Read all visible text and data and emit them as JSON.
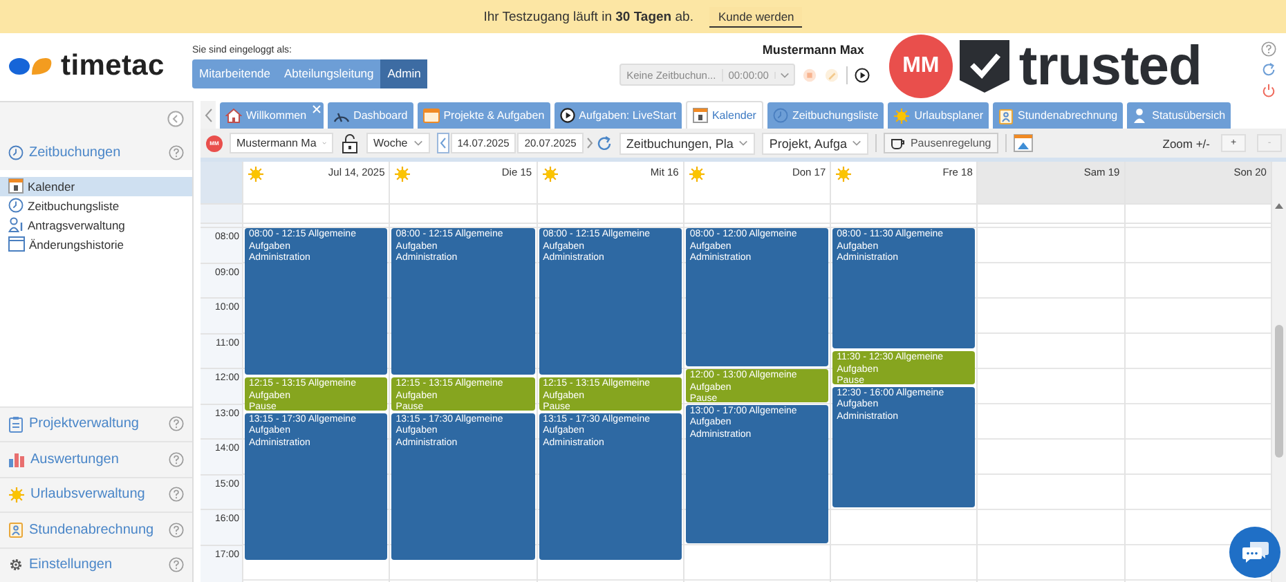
{
  "banner": {
    "message": "Ihr Testzugang läuft in **30 Tagen** ab.",
    "action": "Kunde werden"
  },
  "header": {
    "logo": "timetac",
    "login_label": "Sie sind eingeloggt als:",
    "roles": [
      {
        "label": "Mitarbeitende",
        "selected": false
      },
      {
        "label": "Abteilungsleitung",
        "selected": false
      },
      {
        "label": "Admin",
        "selected": true
      }
    ],
    "user_name": "Mustermann Max",
    "timer": {
      "value": "Keine Zeitbuchun...",
      "time": "00:00:00"
    },
    "avatar": "MM",
    "trust_badge": "trusted"
  },
  "sidebar": {
    "sections": [
      {
        "label": "Zeitbuchungen",
        "children": [
          {
            "label": "Kalender",
            "selected": true
          },
          {
            "label": "Zeitbuchungsliste",
            "selected": false
          },
          {
            "label": "Antragsverwaltung",
            "selected": false
          },
          {
            "label": "Änderungshistorie",
            "selected": false
          }
        ]
      },
      {
        "label": "Projektverwaltung"
      },
      {
        "label": "Auswertungen"
      },
      {
        "label": "Urlaubsverwaltung"
      },
      {
        "label": "Stundenabrechnung"
      },
      {
        "label": "Einstellungen"
      }
    ]
  },
  "tabs": [
    {
      "label": "Willkommen",
      "selected": false,
      "closable": true
    },
    {
      "label": "Dashboard",
      "selected": false,
      "closable": false
    },
    {
      "label": "Projekte & Aufgaben",
      "selected": false,
      "closable": false
    },
    {
      "label": "Aufgaben: LiveStart",
      "selected": false,
      "closable": false
    },
    {
      "label": "Kalender",
      "selected": true,
      "closable": false
    },
    {
      "label": "Zeitbuchungsliste",
      "selected": false,
      "closable": false
    },
    {
      "label": "Urlaubsplaner",
      "selected": false,
      "closable": false
    },
    {
      "label": "Stundenabrechnung",
      "selected": false,
      "closable": false
    },
    {
      "label": "Statusübersich",
      "selected": false,
      "closable": false
    }
  ],
  "toolbar": {
    "avatar": "MM",
    "employee": "Mustermann Ma",
    "view": "Woche",
    "date_from": "14.07.2025",
    "date_to": "20.07.2025",
    "filter_1": "Zeitbuchungen, Pla",
    "filter_2": "Projekt, Aufga",
    "break_button": "Pausenregelung",
    "zoom_label": "Zoom +/-",
    "zoom_in": {
      "label": "+",
      "disabled": false
    },
    "zoom_out": {
      "label": "-",
      "disabled": true
    }
  },
  "calendar": {
    "hours": [
      "08:00",
      "09:00",
      "10:00",
      "11:00",
      "12:00",
      "13:00",
      "14:00",
      "15:00",
      "16:00",
      "17:00"
    ],
    "days": [
      {
        "label": "Jul 14, 2025",
        "kind": "workday",
        "events": [
          {
            "kind": "work",
            "time": "08:00 - 12:15",
            "title": "Allgemeine",
            "lines": [
              "Aufgaben",
              "Administration"
            ]
          },
          {
            "kind": "break",
            "time": "12:15 - 13:15",
            "title": "Allgemeine",
            "lines": [
              "Aufgaben",
              "Pause"
            ]
          },
          {
            "kind": "work",
            "time": "13:15 - 17:30",
            "title": "Allgemeine",
            "lines": [
              "Aufgaben",
              "Administration"
            ]
          }
        ]
      },
      {
        "label": "Die 15",
        "kind": "workday",
        "events": [
          {
            "kind": "work",
            "time": "08:00 - 12:15",
            "title": "Allgemeine",
            "lines": [
              "Aufgaben",
              "Administration"
            ]
          },
          {
            "kind": "break",
            "time": "12:15 - 13:15",
            "title": "Allgemeine",
            "lines": [
              "Aufgaben",
              "Pause"
            ]
          },
          {
            "kind": "work",
            "time": "13:15 - 17:30",
            "title": "Allgemeine",
            "lines": [
              "Aufgaben",
              "Administration"
            ]
          }
        ]
      },
      {
        "label": "Mit 16",
        "kind": "workday",
        "events": [
          {
            "kind": "work",
            "time": "08:00 - 12:15",
            "title": "Allgemeine",
            "lines": [
              "Aufgaben",
              "Administration"
            ]
          },
          {
            "kind": "break",
            "time": "12:15 - 13:15",
            "title": "Allgemeine",
            "lines": [
              "Aufgaben",
              "Pause"
            ]
          },
          {
            "kind": "work",
            "time": "13:15 - 17:30",
            "title": "Allgemeine",
            "lines": [
              "Aufgaben",
              "Administration"
            ]
          }
        ]
      },
      {
        "label": "Don 17",
        "kind": "workday",
        "events": [
          {
            "kind": "work",
            "time": "08:00 - 12:00",
            "title": "Allgemeine",
            "lines": [
              "Aufgaben",
              "Administration"
            ]
          },
          {
            "kind": "break",
            "time": "12:00 - 13:00",
            "title": "Allgemeine",
            "lines": [
              "Aufgaben",
              "Pause"
            ]
          },
          {
            "kind": "work",
            "time": "13:00 - 17:00",
            "title": "Allgemeine",
            "lines": [
              "Aufgaben",
              "Administration"
            ]
          }
        ]
      },
      {
        "label": "Fre 18",
        "kind": "workday",
        "events": [
          {
            "kind": "work",
            "time": "08:00 - 11:30",
            "title": "Allgemeine",
            "lines": [
              "Aufgaben",
              "Administration"
            ]
          },
          {
            "kind": "break",
            "time": "11:30 - 12:30",
            "title": "Allgemeine",
            "lines": [
              "Aufgaben",
              "Pause"
            ]
          },
          {
            "kind": "work",
            "time": "12:30 - 16:00",
            "title": "Allgemeine",
            "lines": [
              "Aufgaben",
              "Administration"
            ]
          }
        ]
      },
      {
        "label": "Sam 19",
        "kind": "weekend"
      },
      {
        "label": "Son 20",
        "kind": "weekend"
      }
    ]
  }
}
